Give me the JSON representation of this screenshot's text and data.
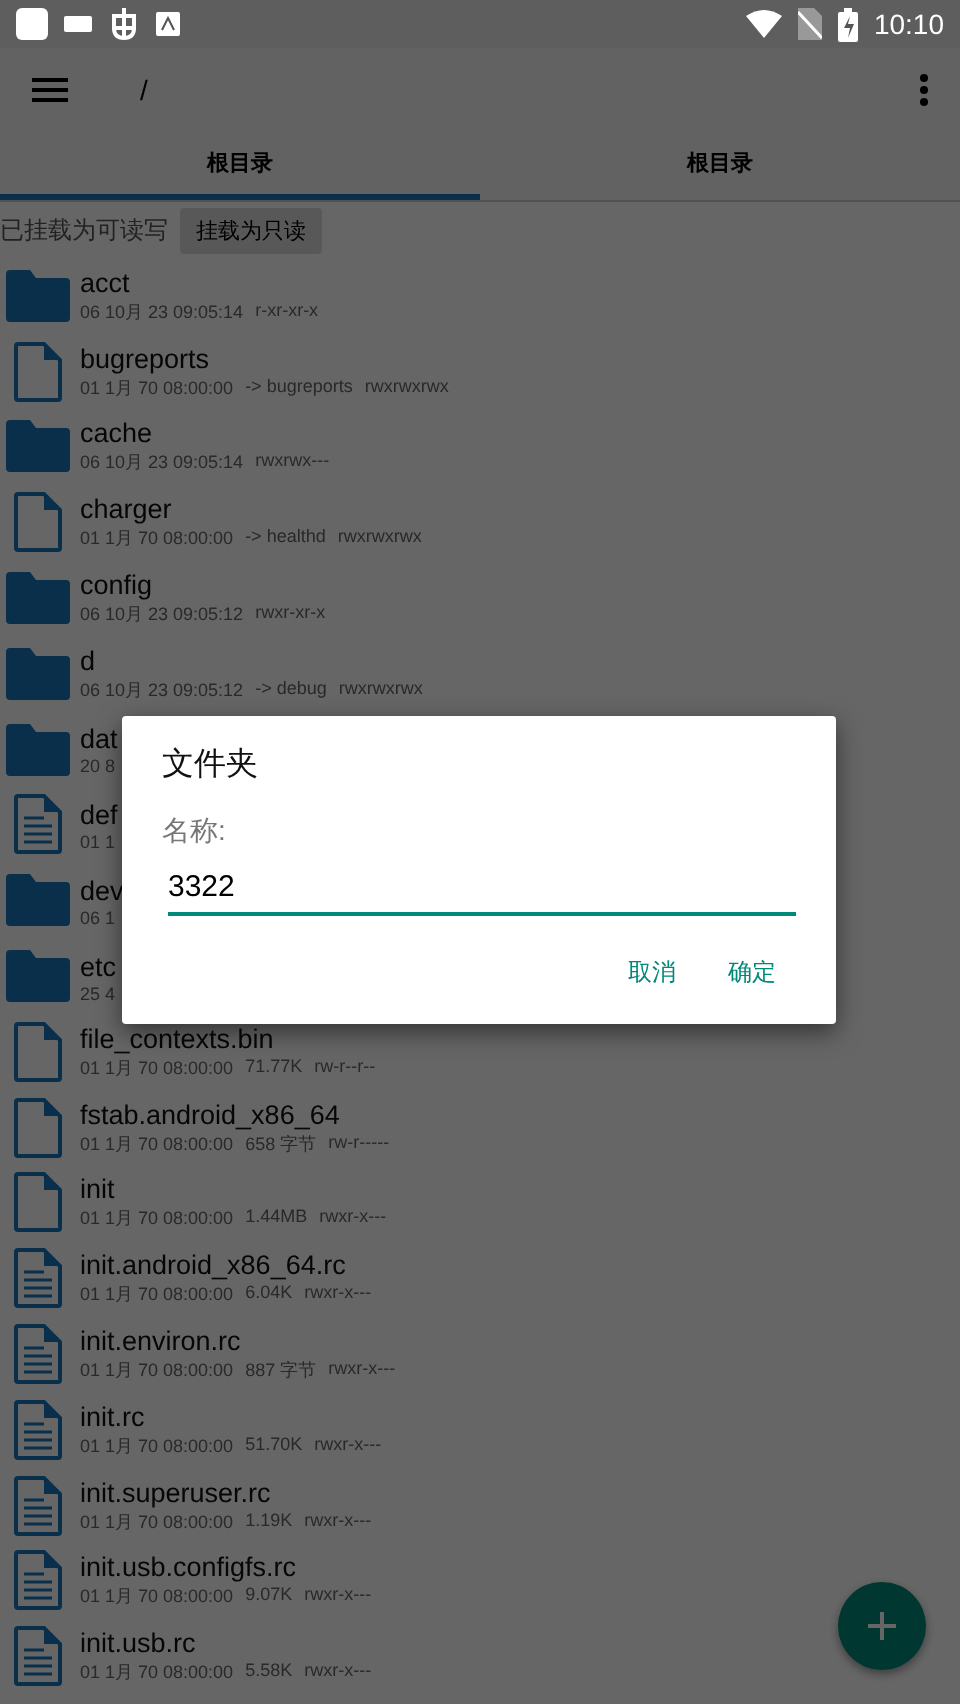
{
  "status_bar": {
    "time": "10:10"
  },
  "toolbar": {
    "path": "/"
  },
  "tabs": [
    {
      "label": "根目录",
      "selected": true
    },
    {
      "label": "根目录",
      "selected": false
    }
  ],
  "mount": {
    "status": "已挂载为可读写",
    "button": "挂载为只读"
  },
  "files": [
    {
      "kind": "folder",
      "name": "acct",
      "meta": [
        "06 10月 23 09:05:14",
        "r-xr-xr-x"
      ]
    },
    {
      "kind": "file",
      "name": "bugreports",
      "meta": [
        "01 1月 70 08:00:00",
        "-> bugreports",
        "rwxrwxrwx"
      ]
    },
    {
      "kind": "folder",
      "name": "cache",
      "meta": [
        "06 10月 23 09:05:14",
        "rwxrwx---"
      ]
    },
    {
      "kind": "file",
      "name": "charger",
      "meta": [
        "01 1月 70 08:00:00",
        "-> healthd",
        "rwxrwxrwx"
      ]
    },
    {
      "kind": "folder",
      "name": "config",
      "meta": [
        "06 10月 23 09:05:12",
        "rwxr-xr-x"
      ]
    },
    {
      "kind": "folder",
      "name": "d",
      "meta": [
        "06 10月 23 09:05:12",
        "-> debug",
        "rwxrwxrwx"
      ]
    },
    {
      "kind": "folder",
      "name": "dat",
      "meta": [
        "20 8"
      ]
    },
    {
      "kind": "text",
      "name": "def",
      "meta": [
        "01 1"
      ]
    },
    {
      "kind": "folder",
      "name": "dev",
      "meta": [
        "06 1"
      ]
    },
    {
      "kind": "folder",
      "name": "etc",
      "meta": [
        "25 4"
      ]
    },
    {
      "kind": "file",
      "name": "file_contexts.bin",
      "meta": [
        "01 1月 70 08:00:00",
        "71.77K",
        "rw-r--r--"
      ]
    },
    {
      "kind": "file",
      "name": "fstab.android_x86_64",
      "meta": [
        "01 1月 70 08:00:00",
        "658 字节",
        "rw-r-----"
      ]
    },
    {
      "kind": "file",
      "name": "init",
      "meta": [
        "01 1月 70 08:00:00",
        "1.44MB",
        "rwxr-x---"
      ]
    },
    {
      "kind": "text",
      "name": "init.android_x86_64.rc",
      "meta": [
        "01 1月 70 08:00:00",
        "6.04K",
        "rwxr-x---"
      ]
    },
    {
      "kind": "text",
      "name": "init.environ.rc",
      "meta": [
        "01 1月 70 08:00:00",
        "887 字节",
        "rwxr-x---"
      ]
    },
    {
      "kind": "text",
      "name": "init.rc",
      "meta": [
        "01 1月 70 08:00:00",
        "51.70K",
        "rwxr-x---"
      ]
    },
    {
      "kind": "text",
      "name": "init.superuser.rc",
      "meta": [
        "01 1月 70 08:00:00",
        "1.19K",
        "rwxr-x---"
      ]
    },
    {
      "kind": "text",
      "name": "init.usb.configfs.rc",
      "meta": [
        "01 1月 70 08:00:00",
        "9.07K",
        "rwxr-x---"
      ]
    },
    {
      "kind": "text",
      "name": "init.usb.rc",
      "meta": [
        "01 1月 70 08:00:00",
        "5.58K",
        "rwxr-x---"
      ]
    }
  ],
  "dialog": {
    "title": "文件夹",
    "label": "名称:",
    "value": "3322",
    "buttons": [
      "取消",
      "确定"
    ]
  }
}
